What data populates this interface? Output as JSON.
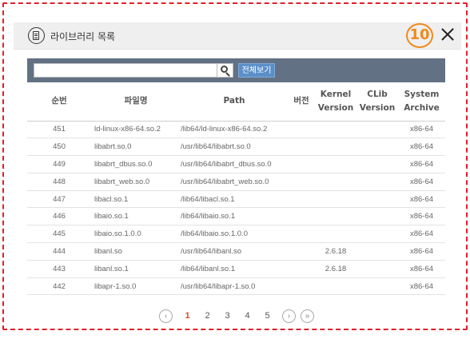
{
  "header": {
    "title": "라이브러리 목록",
    "step_badge": "10",
    "icon": "document-list-icon",
    "close_icon": "close-icon"
  },
  "search": {
    "placeholder": "",
    "value": "",
    "button_icon": "search-icon",
    "view_all_label": "전체보기"
  },
  "table": {
    "headers": {
      "no": "순번",
      "file": "파일명",
      "path": "Path",
      "version": "버전",
      "kernel_1": "Kernel",
      "kernel_2": "Version",
      "clib_1": "CLib",
      "clib_2": "Version",
      "arch_1": "System",
      "arch_2": "Archive"
    },
    "rows": [
      {
        "no": "451",
        "file": "ld-linux-x86-64.so.2",
        "path": "/lib64/ld-linux-x86-64.so.2",
        "version": "",
        "kernel": "",
        "clib": "",
        "arch": "x86-64"
      },
      {
        "no": "450",
        "file": "libabrt.so.0",
        "path": "/usr/lib64/libabrt.so.0",
        "version": "",
        "kernel": "",
        "clib": "",
        "arch": "x86-64"
      },
      {
        "no": "449",
        "file": "libabrt_dbus.so.0",
        "path": "/usr/lib64/libabrt_dbus.so.0",
        "version": "",
        "kernel": "",
        "clib": "",
        "arch": "x86-64"
      },
      {
        "no": "448",
        "file": "libabrt_web.so.0",
        "path": "/usr/lib64/libabrt_web.so.0",
        "version": "",
        "kernel": "",
        "clib": "",
        "arch": "x86-64"
      },
      {
        "no": "447",
        "file": "libacl.so.1",
        "path": "/lib64/libacl.so.1",
        "version": "",
        "kernel": "",
        "clib": "",
        "arch": "x86-64"
      },
      {
        "no": "446",
        "file": "libaio.so.1",
        "path": "/lib64/libaio.so.1",
        "version": "",
        "kernel": "",
        "clib": "",
        "arch": "x86-64"
      },
      {
        "no": "445",
        "file": "libaio.so.1.0.0",
        "path": "/lib64/libaio.so.1.0.0",
        "version": "",
        "kernel": "",
        "clib": "",
        "arch": "x86-64"
      },
      {
        "no": "444",
        "file": "libanl.so",
        "path": "/usr/lib64/libanl.so",
        "version": "",
        "kernel": "2.6.18",
        "clib": "",
        "arch": "x86-64"
      },
      {
        "no": "443",
        "file": "libanl.so.1",
        "path": "/lib64/libanl.so.1",
        "version": "",
        "kernel": "2.6.18",
        "clib": "",
        "arch": "x86-64"
      },
      {
        "no": "442",
        "file": "libapr-1.so.0",
        "path": "/usr/lib64/libapr-1.so.0",
        "version": "",
        "kernel": "",
        "clib": "",
        "arch": "x86-64"
      }
    ]
  },
  "pagination": {
    "prev": "‹",
    "next": "›",
    "last": "»",
    "pages": [
      "1",
      "2",
      "3",
      "4",
      "5"
    ],
    "current": "1"
  },
  "colors": {
    "accent_orange": "#f08a1c",
    "frame_red": "#e0202a",
    "search_bar": "#637185",
    "button_blue": "#5a8fc8",
    "current_page": "#e8471e"
  }
}
